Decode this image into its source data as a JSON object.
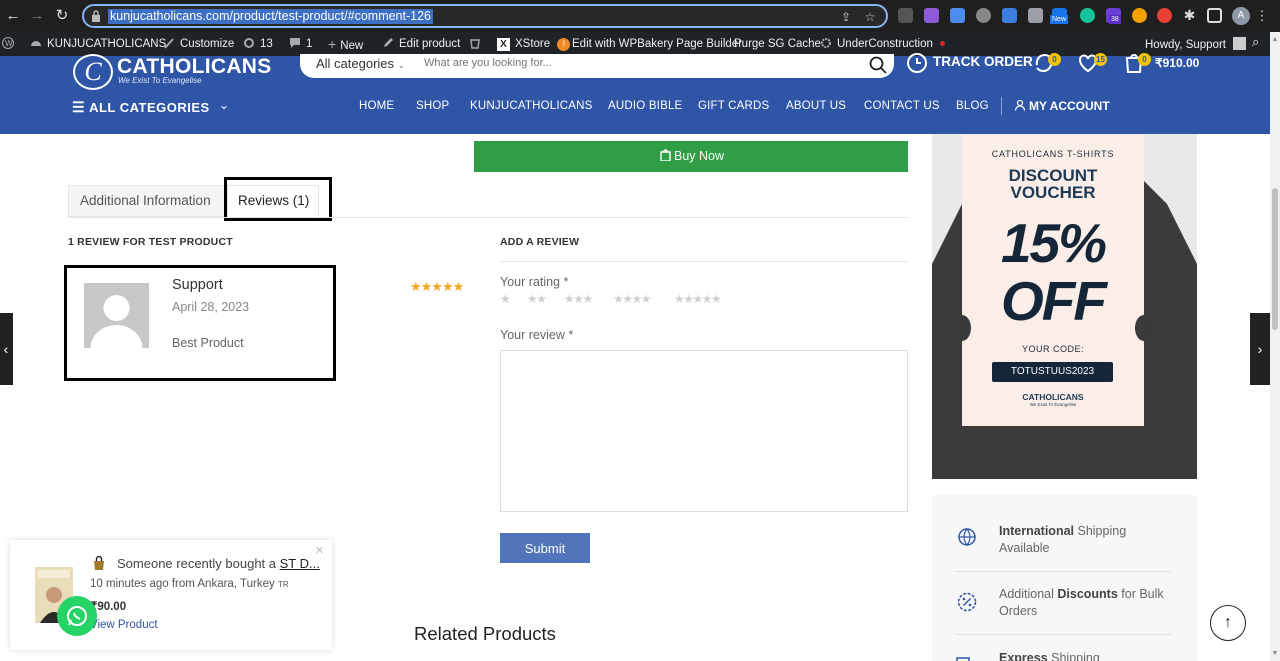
{
  "browser": {
    "url": "kunjucatholicans.com/product/test-product/#comment-126",
    "profile_initial": "A",
    "ext_badges": [
      "New",
      "38"
    ]
  },
  "wp_admin": {
    "site_name": "KUNJUCATHOLICANS",
    "customize": "Customize",
    "updates": "13",
    "comments": "1",
    "new": "New",
    "edit_product": "Edit product",
    "xstore": "XStore",
    "wpbakery": "Edit with WPBakery Page Builder",
    "purge": "Purge SG Cache",
    "under_construction": "UnderConstruction",
    "howdy": "Howdy, Support"
  },
  "header": {
    "logo_title": "CATHOLICANS",
    "logo_tagline": "We Exist To Evangelise",
    "search_category": "All categories",
    "search_placeholder": "What are you looking for...",
    "track_order": "TRACK ORDER",
    "compare_count": "0",
    "wishlist_count": "15",
    "cart_count": "0",
    "cart_total": "₹910.00",
    "all_categories": "ALL CATEGORIES",
    "menu": [
      "HOME",
      "SHOP",
      "KUNJUCATHOLICANS",
      "AUDIO BIBLE",
      "GIFT CARDS",
      "ABOUT US",
      "CONTACT US",
      "BLOG"
    ],
    "my_account": "MY ACCOUNT"
  },
  "product": {
    "buy_now": "Buy Now",
    "tabs": [
      "Additional Information",
      "Reviews (1)"
    ],
    "reviews_heading": "1 REVIEW FOR TEST PRODUCT",
    "review": {
      "author": "Support",
      "date": "April 28, 2023",
      "text": "Best Product",
      "rating": 5
    },
    "add_review_heading": "ADD A REVIEW",
    "your_rating": "Your rating *",
    "your_review": "Your review *",
    "submit": "Submit",
    "related": "Related Products"
  },
  "sidebar": {
    "voucher": {
      "line1": "CATHOLICANS T-SHIRTS",
      "line2a": "DISCOUNT",
      "line2b": "VOUCHER",
      "amount": "15% OFF",
      "code_label": "YOUR CODE:",
      "code": "TOTUSTUUS2023",
      "brand": "CATHOLICANS",
      "brand_tag": "We Exist To Evangelise"
    },
    "features": [
      {
        "bold": "International",
        "rest": " Shipping Available"
      },
      {
        "pre": "Additional ",
        "bold": "Discounts",
        "rest": " for Bulk Orders"
      },
      {
        "bold": "Express",
        "rest": " Shipping"
      }
    ]
  },
  "popup": {
    "title_prefix": "Someone recently bought a ",
    "title_product": "ST D...",
    "when": "10 minutes ago from Ankara, Turkey",
    "country_code": "TR",
    "price": "₹90.00",
    "link": "View Product"
  },
  "colors": {
    "brand_blue": "#2f56a6",
    "buy_green": "#2f9e44",
    "star_gold": "#f5a623",
    "submit_blue": "#5174ba"
  }
}
